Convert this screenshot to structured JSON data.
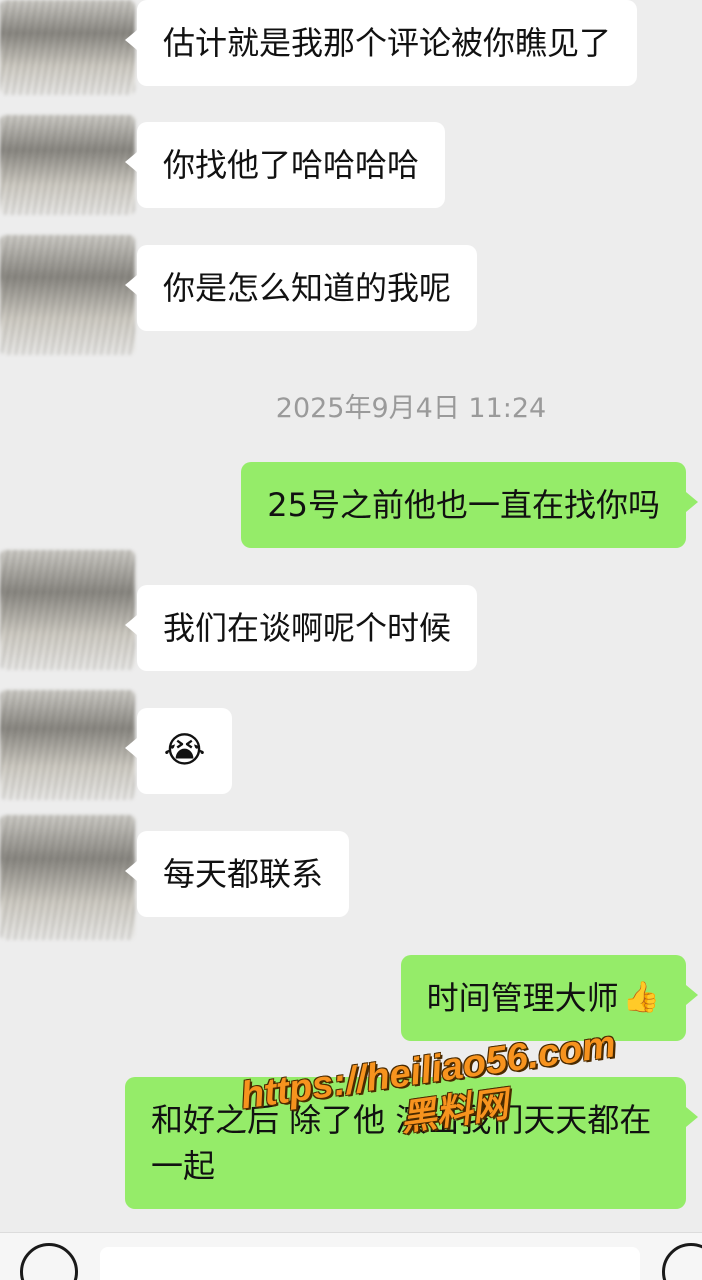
{
  "conversation": {
    "messages_top": [
      {
        "side": "left",
        "text": "估计就是我那个评论被你瞧见了"
      },
      {
        "side": "left",
        "text": "你找他了哈哈哈哈"
      },
      {
        "side": "left",
        "text": "你是怎么知道的我呢"
      }
    ],
    "timestamp": "2025年9月4日 11:24",
    "messages_bottom": [
      {
        "side": "right",
        "text": "25号之前他也一直在找你吗"
      },
      {
        "side": "left",
        "text": "我们在谈啊呢个时候"
      },
      {
        "side": "left",
        "emoji": "😭"
      },
      {
        "side": "left",
        "text": "每天都联系"
      },
      {
        "side": "right",
        "text": "时间管理大师",
        "emoji": "👍"
      },
      {
        "side": "right",
        "text": "和好之后 除了他 演出我们天天都在一起"
      }
    ]
  },
  "watermark": {
    "url": "https://heiliao56.com",
    "name": "黑料网"
  },
  "colors": {
    "background": "#ededed",
    "incoming_bubble": "#ffffff",
    "outgoing_bubble": "#95ec69",
    "timestamp_text": "#9a9a9a",
    "watermark": "#f7931e"
  },
  "input_bar": {
    "voice_icon": "voice-icon",
    "emoji_icon": "emoji-icon"
  }
}
